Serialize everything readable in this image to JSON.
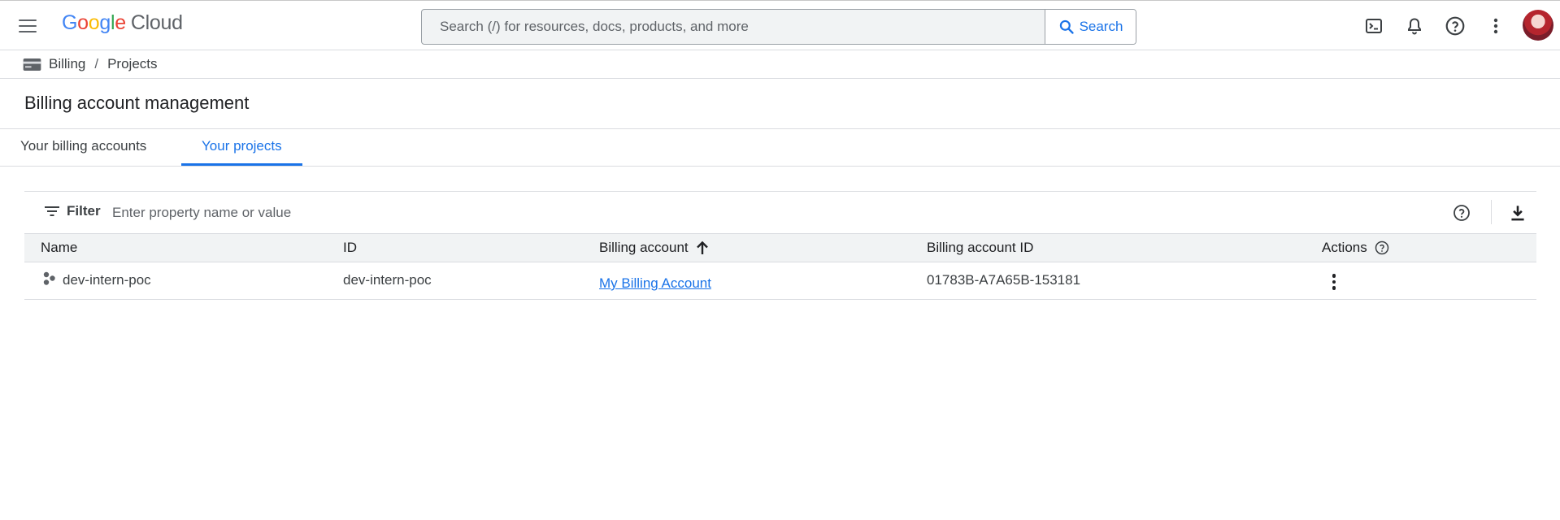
{
  "header": {
    "logo_parts": [
      "G",
      "o",
      "o",
      "g",
      "l",
      "e"
    ],
    "logo_product": "Cloud",
    "search": {
      "placeholder": "Search (/) for resources, docs, products, and more",
      "value": "",
      "button_label": "Search"
    },
    "icons": [
      "terminal-icon",
      "bell-icon",
      "help-icon",
      "more-vert-icon",
      "avatar"
    ]
  },
  "breadcrumb": {
    "items": [
      "Billing",
      "Projects"
    ],
    "separator": "/"
  },
  "page": {
    "title": "Billing account management"
  },
  "tabs": [
    {
      "label": "Your billing accounts",
      "active": false
    },
    {
      "label": "Your projects",
      "active": true
    }
  ],
  "table": {
    "filter": {
      "label": "Filter",
      "placeholder": "Enter property name or value",
      "value": ""
    },
    "columns": [
      "Name",
      "ID",
      "Billing account",
      "Billing account ID",
      "Actions"
    ],
    "sort": {
      "column": "Billing account",
      "direction": "ascending"
    },
    "rows": [
      {
        "name": "dev-intern-poc",
        "id": "dev-intern-poc",
        "billing_account": "My Billing Account",
        "billing_account_id": "01783B-A7A65B-153181"
      }
    ]
  },
  "colors": {
    "accent": "#1a73e8",
    "text": "#202124",
    "muted": "#5f6368",
    "border": "#dadce0",
    "header_bg": "#f1f3f4"
  }
}
